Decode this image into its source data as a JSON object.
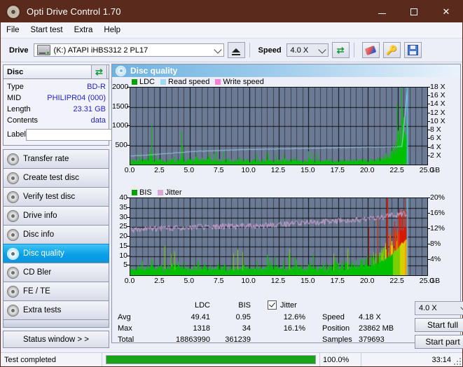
{
  "window": {
    "title": "Opti Drive Control 1.70",
    "icon": "disc-icon",
    "minimize": "minimize-icon",
    "maximize": "maximize-icon",
    "close": "close-icon"
  },
  "menu": [
    "File",
    "Start test",
    "Extra",
    "Help"
  ],
  "toolbar": {
    "drive_label": "Drive",
    "drive_value": "(K:)  ATAPI iHBS312   2 PL17",
    "eject_icon": "eject-icon",
    "speed_label": "Speed",
    "speed_value": "4.0 X",
    "refresh_icon": "refresh-icon",
    "erase_icon": "eraser-icon",
    "key_icon": "key-icon",
    "save_icon": "save-icon"
  },
  "disc": {
    "title": "Disc",
    "refresh_icon": "refresh-icon",
    "rows": [
      {
        "label": "Type",
        "value": "BD-R"
      },
      {
        "label": "MID",
        "value": "PHILIPR04 (000)"
      },
      {
        "label": "Length",
        "value": "23.31 GB"
      },
      {
        "label": "Contents",
        "value": "data"
      }
    ],
    "label_field": {
      "label": "Label",
      "value": "",
      "placeholder": ""
    },
    "label_button_icon": "cd-icon"
  },
  "nav": {
    "items": [
      {
        "id": "transfer-rate",
        "label": "Transfer rate",
        "selected": false
      },
      {
        "id": "create-test-disc",
        "label": "Create test disc",
        "selected": false
      },
      {
        "id": "verify-test-disc",
        "label": "Verify test disc",
        "selected": false
      },
      {
        "id": "drive-info",
        "label": "Drive info",
        "selected": false
      },
      {
        "id": "disc-info",
        "label": "Disc info",
        "selected": false
      },
      {
        "id": "disc-quality",
        "label": "Disc quality",
        "selected": true
      },
      {
        "id": "cd-bler",
        "label": "CD Bler",
        "selected": false
      },
      {
        "id": "fe-te",
        "label": "FE / TE",
        "selected": false
      },
      {
        "id": "extra-tests",
        "label": "Extra tests",
        "selected": false
      }
    ],
    "status_window": "Status window > >"
  },
  "panel": {
    "title": "Disc quality",
    "icon": "disc-quality-icon"
  },
  "chart_data": [
    {
      "type": "area",
      "name": "ldc-chart",
      "title": "",
      "xlabel": "GB",
      "ylabel": "",
      "xlim": [
        0,
        25
      ],
      "ylim": [
        0,
        2000
      ],
      "y2lim": [
        0,
        18
      ],
      "y2label": "X",
      "xticks": [
        "0.0",
        "2.5",
        "5.0",
        "7.5",
        "10.0",
        "12.5",
        "15.0",
        "17.5",
        "20.0",
        "22.5",
        "25.0"
      ],
      "yticks": [
        "500",
        "1000",
        "1500",
        "2000"
      ],
      "y2ticks": [
        "2 X",
        "4 X",
        "6 X",
        "8 X",
        "10 X",
        "12 X",
        "14 X",
        "16 X",
        "18 X"
      ],
      "grid": true,
      "legend": [
        "LDC",
        "Read speed",
        "Write speed"
      ],
      "legend_colors": [
        "#00a000",
        "#9fd8f5",
        "#f77fd8"
      ],
      "series": [
        {
          "name": "LDC",
          "color": "#00c000",
          "kind": "spikes",
          "values": [
            120,
            90,
            150,
            110,
            95,
            130,
            100,
            350,
            120,
            95,
            140,
            110,
            160,
            105,
            95,
            120,
            480,
            150,
            110,
            130,
            95,
            100,
            230,
            120,
            95,
            140,
            110,
            90,
            130,
            150,
            100,
            95,
            120,
            280,
            110,
            95,
            130,
            100,
            120,
            95,
            460,
            150,
            110,
            95,
            130,
            100,
            120,
            180,
            95,
            110,
            130,
            230,
            100,
            95,
            120,
            150,
            110,
            95,
            130,
            100,
            260,
            120,
            95,
            140,
            110,
            95,
            130,
            170,
            100,
            120,
            95,
            110,
            130,
            100,
            95,
            120,
            210,
            110,
            95,
            130,
            100,
            120,
            95,
            110,
            130,
            190,
            100,
            95,
            120,
            110,
            130,
            100,
            95,
            120,
            110,
            160,
            95,
            130,
            100,
            120,
            95,
            110,
            130,
            100,
            95,
            120,
            110,
            230,
            130,
            100,
            95,
            120,
            110,
            95,
            130,
            100,
            120,
            95,
            110,
            260,
            130,
            100,
            95,
            120,
            110,
            95,
            130,
            180,
            100,
            120,
            95,
            110,
            130,
            100,
            95,
            120,
            110,
            95,
            130,
            100,
            210,
            120,
            95,
            110,
            130,
            100,
            95,
            120,
            110,
            95,
            130,
            100,
            120,
            95,
            110,
            130,
            100,
            95,
            120,
            110,
            95,
            130,
            100,
            120,
            95,
            110,
            130,
            100,
            95,
            120,
            110,
            95,
            130,
            100,
            120,
            150,
            110,
            130,
            100,
            120,
            95,
            110,
            130,
            140,
            120,
            110,
            130,
            150,
            120,
            140,
            130,
            160,
            150,
            170,
            160,
            180,
            190,
            200,
            220,
            240,
            260,
            290,
            320,
            360,
            400,
            450,
            520,
            600,
            700,
            820,
            960,
            1130,
            1318,
            1200,
            900
          ]
        },
        {
          "name": "Read speed",
          "color": "#a8dcf7",
          "kind": "line",
          "values": [
            2.0,
            2.1,
            2.15,
            2.2,
            2.3,
            2.4,
            2.5,
            2.6,
            2.7,
            2.8,
            2.9,
            3.0,
            3.05,
            3.1,
            3.15,
            3.2,
            3.25,
            3.3,
            3.35,
            3.4,
            3.45,
            3.5,
            3.52,
            3.55,
            3.58,
            3.6,
            3.62,
            3.65,
            3.68,
            3.7,
            3.72,
            3.75,
            3.78,
            3.8,
            3.82,
            3.85,
            3.88,
            3.9,
            3.92,
            3.95,
            3.98,
            4.0,
            4.02,
            4.05,
            4.08,
            4.1,
            4.1,
            4.12,
            4.14,
            4.16,
            4.18,
            4.2,
            17.5
          ]
        }
      ]
    },
    {
      "type": "area",
      "name": "bis-jitter-chart",
      "title": "",
      "xlabel": "GB",
      "xlim": [
        0,
        25
      ],
      "ylim": [
        0,
        40
      ],
      "y2lim": [
        0,
        20
      ],
      "y2label": "%",
      "xticks": [
        "0.0",
        "2.5",
        "5.0",
        "7.5",
        "10.0",
        "12.5",
        "15.0",
        "17.5",
        "20.0",
        "22.5",
        "25.0"
      ],
      "yticks": [
        "5",
        "10",
        "15",
        "20",
        "25",
        "30",
        "35",
        "40"
      ],
      "y2ticks": [
        "4%",
        "8%",
        "12%",
        "16%",
        "20%"
      ],
      "grid": true,
      "legend": [
        "BIS",
        "Jitter"
      ],
      "legend_colors": [
        "#00a000",
        "#d9a8d8"
      ],
      "series": [
        {
          "name": "BIS",
          "color": "#00c000",
          "kind": "spikes",
          "values": [
            3.0,
            4.0,
            3.2,
            5.5,
            3.5,
            4.2,
            3.1,
            6.2,
            3.6,
            4.1,
            3.3,
            5.0,
            3.4,
            7.8,
            3.2,
            4.5,
            3.1,
            5.2,
            3.7,
            4.0,
            3.3,
            6.0,
            3.5,
            4.4,
            3.2,
            10.3,
            3.6,
            4.8,
            3.1,
            5.4,
            3.3,
            4.2,
            3.5,
            6.6,
            3.2,
            4.1,
            3.4,
            5.0,
            3.1,
            4.6,
            3.3,
            7.0,
            3.5,
            4.2,
            3.2,
            5.8,
            3.4,
            4.0,
            3.1,
            6.2,
            3.3,
            4.5,
            3.6,
            8.9,
            3.2,
            4.3,
            3.1,
            5.2,
            3.5,
            4.1,
            3.3,
            6.0,
            3.4,
            4.7,
            3.2,
            5.5,
            3.1,
            4.2,
            3.6,
            7.6,
            3.3,
            4.4,
            3.2,
            5.0,
            3.5,
            4.1,
            3.1,
            6.1,
            3.4,
            4.9,
            3.2,
            5.3,
            3.3,
            4.0,
            3.6,
            6.9,
            3.1,
            4.3,
            3.5,
            5.1,
            3.2,
            4.6,
            3.3,
            7.2,
            3.4,
            4.2,
            3.1,
            5.6,
            3.5,
            4.0,
            3.3,
            6.4,
            3.2,
            4.8,
            3.6,
            5.2,
            3.1,
            4.1,
            3.4,
            7.4,
            3.3,
            4.5,
            3.2,
            5.0,
            3.5,
            4.3,
            3.1,
            6.2,
            3.4,
            5.0,
            3.6,
            5.5,
            3.8,
            4.6,
            4.0,
            7.0,
            4.2,
            5.1,
            4.4,
            6.0,
            4.6,
            5.4,
            4.8,
            6.6,
            5.0,
            5.8,
            5.4,
            7.2,
            5.8,
            6.4,
            6.2,
            8.0,
            6.8,
            7.2,
            7.6,
            9.4,
            8.2,
            8.8,
            9.6,
            11.0,
            10.4,
            11.6,
            12.4,
            14.0,
            13.4,
            15.0,
            16.2,
            18.0,
            17.4,
            19.6,
            21.0,
            24.0,
            23.0,
            26.0,
            28.0,
            31.0,
            30.0,
            33.0,
            34.0
          ]
        },
        {
          "name": "Jitter",
          "color": "#d9a8d8",
          "kind": "line",
          "values": [
            12.0,
            11.8,
            12.0,
            11.9,
            12.1,
            12.0,
            12.2,
            12.1,
            12.0,
            12.2,
            12.1,
            12.3,
            12.2,
            12.4,
            12.3,
            12.2,
            12.4,
            12.3,
            12.5,
            12.4,
            12.3,
            12.5,
            12.4,
            12.6,
            12.5,
            12.4,
            12.6,
            12.5,
            12.7,
            12.6,
            12.5,
            12.7,
            12.6,
            12.8,
            12.7,
            12.6,
            12.8,
            12.7,
            12.9,
            12.8,
            12.7,
            12.9,
            12.8,
            13.0,
            12.9,
            12.8,
            13.0,
            12.9,
            13.1,
            13.0,
            13.2,
            13.1,
            13.3,
            13.2,
            13.4,
            13.3,
            13.5,
            13.4,
            13.6,
            13.5,
            13.7,
            13.6,
            13.8,
            13.7,
            13.9,
            13.8,
            14.0,
            13.9,
            14.1,
            14.0,
            14.2,
            14.1,
            14.3,
            14.2,
            14.4,
            14.3,
            14.5,
            14.4,
            14.6,
            14.5,
            14.8,
            14.7,
            15.0,
            14.9,
            15.2,
            15.1,
            15.4,
            15.3,
            15.6,
            15.5,
            15.8,
            15.9,
            16.1,
            15.9
          ]
        }
      ]
    }
  ],
  "stats": {
    "col_headers": [
      "LDC",
      "BIS"
    ],
    "rows": [
      {
        "label": "Avg",
        "ldc": "49.41",
        "bis": "0.95"
      },
      {
        "label": "Max",
        "ldc": "1318",
        "bis": "34"
      },
      {
        "label": "Total",
        "ldc": "18863990",
        "bis": "361239"
      }
    ],
    "jitter": {
      "checkbox_checked": true,
      "label": "Jitter",
      "avg": "12.6%",
      "max": "16.1%"
    },
    "info": [
      {
        "label": "Speed",
        "value": "4.18 X"
      },
      {
        "label": "Position",
        "value": "23862 MB"
      },
      {
        "label": "Samples",
        "value": "379693"
      }
    ],
    "speed_select": "4.0 X",
    "start_full": "Start full",
    "start_part": "Start part"
  },
  "statusbar": {
    "message": "Test completed",
    "progress_percent": "100.0%",
    "progress_value": 100,
    "elapsed": "33:14"
  },
  "colors": {
    "titlebar": "#5a2a1c",
    "accent": "#0aa0e6",
    "value_text": "#2222cc",
    "plot_bg": "#6b7a95",
    "green": "#00c000"
  }
}
